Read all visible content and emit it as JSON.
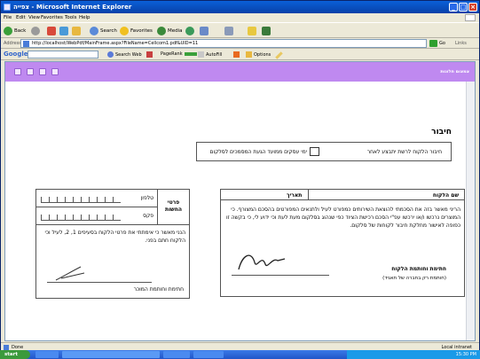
{
  "window": {
    "title": "צפייה - Microsoft Internet Explorer"
  },
  "menu": [
    "File",
    "Edit",
    "View",
    "Favorites",
    "Tools",
    "Help"
  ],
  "toolbar": {
    "back": "Back",
    "search": "Search",
    "favorites": "Favorites",
    "media": "Media"
  },
  "address": {
    "label": "Address",
    "url": "http://localhost/WebPdf/MainFrame.aspx?FileName=Cellcom1.pdf&UID=11",
    "go": "Go",
    "links": "Links"
  },
  "google_bar": {
    "logo": "Google",
    "search_web": "Search Web",
    "pagerank": "PageRank",
    "autofill": "AutoFill",
    "options": "Options"
  },
  "purple_bar": {
    "text": "צמצום חלונות"
  },
  "form": {
    "heading": "חיבור",
    "consent_text": "חיבור הלקוח לרשת יתבצע לאחר",
    "consent_text2": "ימי עסקים ממועד הגעת המסמכים לסלקום",
    "left_panel": {
      "title_line1": "פרטי",
      "title_line2": "החשות",
      "phone_label": "טלפון",
      "fax_label": "פקס",
      "declaration": "הנני מאשר כי אימתתי את פרטי הלקוח בסעיפים 1, 2, לעיל וכי הלקוח חתם בפני.",
      "signature_label": "חתימת וחותמת המוכר"
    },
    "right_panel": {
      "customer_name_label": "שם הלקוח",
      "date_label": "תאריך",
      "body": "הריני מאשר בזה את הסכמתי להוצאת השירותים כמפורט לעיל ולתנאים המפורטים בהסכם המצורף. כי המוצרים נרכשו ו/או ירכשו עפ\"י הסכם רכישת הציוד כפי שנהוג בסלקום מעת לעת וכי ידוע לי, כי בקשה זו כפופה לאישור מחלקת חיבור לקוחות של סלקום.",
      "signature_label": "חתימת וחותמת הלקוח",
      "signature_note": "(חותמת רק בחברה של תאגיד)"
    }
  },
  "status": {
    "text": "Done",
    "zone": "Local intranet"
  },
  "taskbar": {
    "start": "start",
    "clock": "15:30 PM"
  }
}
